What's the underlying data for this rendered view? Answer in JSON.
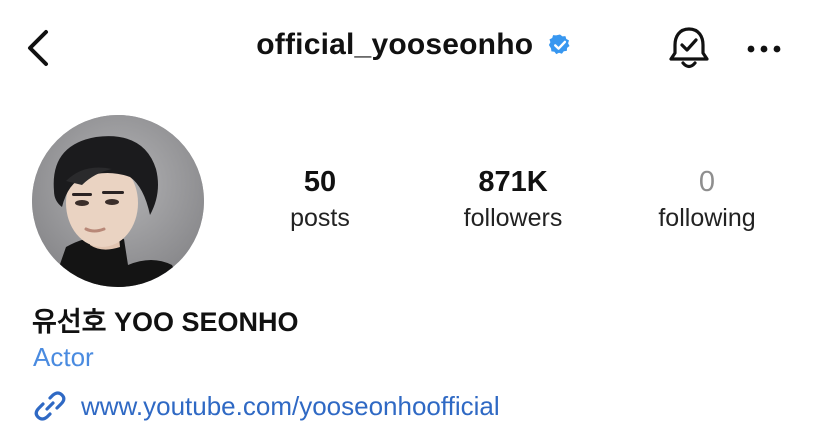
{
  "header": {
    "back_icon": "chevron-left-icon",
    "username": "official_yooseonho",
    "verified_icon": "verified-badge-icon",
    "bell_icon": "notification-bell-icon",
    "more_icon": "more-dots-icon"
  },
  "profile": {
    "avatar": "profile-photo",
    "stats": {
      "posts": {
        "value": "50",
        "label": "posts"
      },
      "followers": {
        "value": "871K",
        "label": "followers"
      },
      "following": {
        "value": "0",
        "label": "following"
      }
    },
    "display_name": "유선호 YOO SEONHO",
    "category": "Actor",
    "link": {
      "icon": "link-icon",
      "text": "www.youtube.com/yooseonhoofficial"
    }
  },
  "colors": {
    "verified": "#3897f0",
    "category": "#4a8be0",
    "link": "#2f69c4",
    "muted": "#8e8e8e"
  }
}
